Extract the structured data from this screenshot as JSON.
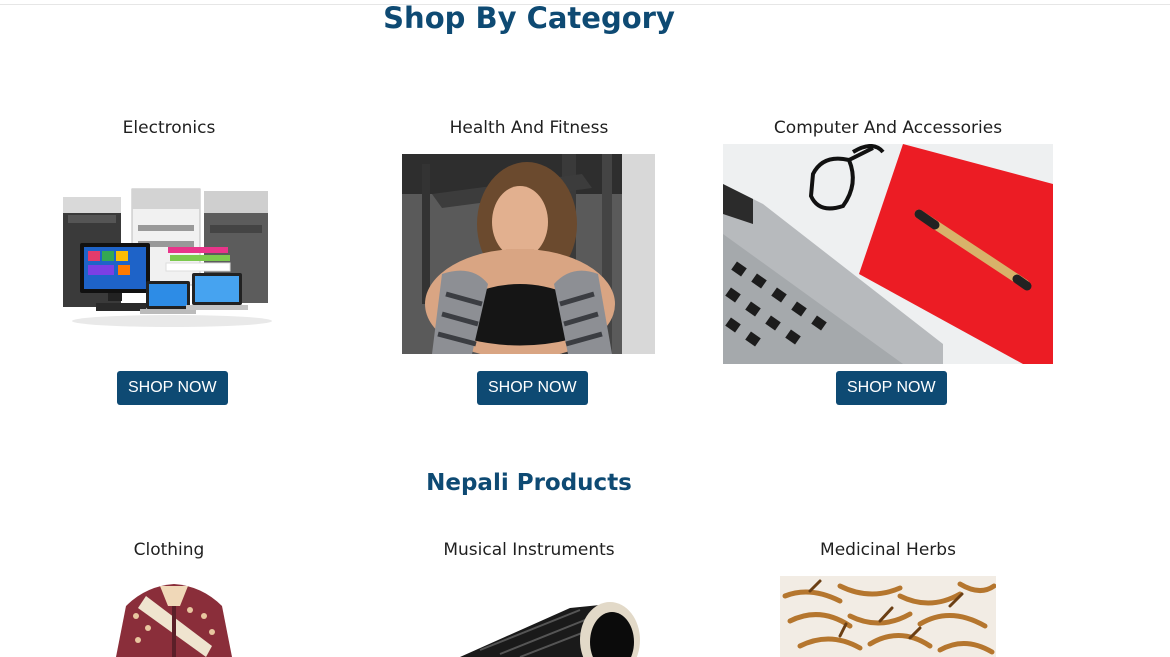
{
  "page": {
    "title": "Shop By Category",
    "nepali_title": "Nepali Products"
  },
  "categories": [
    {
      "label": "Electronics",
      "button": "SHOP NOW",
      "image": "electronics-office-equipment"
    },
    {
      "label": "Health And Fitness",
      "button": "SHOP NOW",
      "image": "fitness-woman-towel"
    },
    {
      "label": "Computer And Accessories",
      "button": "SHOP NOW",
      "image": "laptop-notebook-glasses-pen"
    }
  ],
  "nepali_products": [
    {
      "label": "Clothing",
      "image": "traditional-nepali-shirt"
    },
    {
      "label": "Musical Instruments",
      "image": "madal-drum"
    },
    {
      "label": "Medicinal Herbs",
      "image": "yarsagumba-herb"
    }
  ],
  "colors": {
    "heading": "#0e4a73",
    "button_bg": "#0e4a73",
    "button_text": "#ffffff",
    "label_text": "#1f1f1f"
  }
}
